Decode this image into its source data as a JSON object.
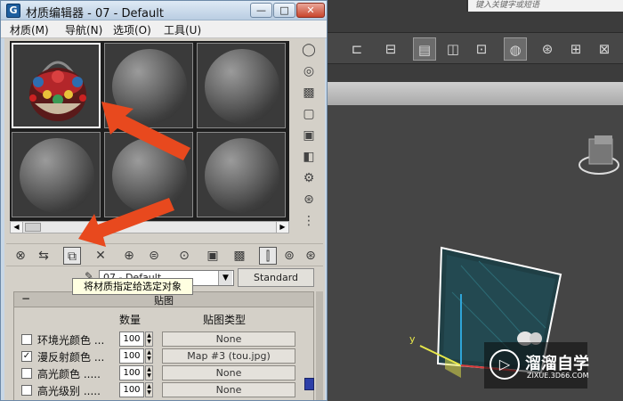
{
  "window": {
    "title": "材质编辑器 - 07 - Default",
    "app_icon": "3dsmax-logo-icon",
    "controls": {
      "minimize": "—",
      "maximize": "□",
      "close": "✕"
    }
  },
  "menu": [
    {
      "label": "材质(M)"
    },
    {
      "label": "导航(N)"
    },
    {
      "label": "选项(O)"
    },
    {
      "label": "工具(U)"
    }
  ],
  "material": {
    "eyedropper_icon": "eyedropper-icon",
    "name": "07 - Default",
    "type_button": "Standard"
  },
  "tooltip": "将材质指定给选定对象",
  "maps_rollout": {
    "collapse": "−",
    "title": "贴图",
    "col_amount": "数量",
    "col_map_type": "贴图类型",
    "rows": [
      {
        "label": "环境光颜色 ...",
        "checked": false,
        "check_mark": "",
        "amount": "100",
        "map": "None"
      },
      {
        "label": "漫反射颜色 ...",
        "checked": true,
        "check_mark": "✓",
        "amount": "100",
        "map": "Map #3 (tou.jpg)"
      },
      {
        "label": "高光颜色 .....",
        "checked": false,
        "check_mark": "",
        "amount": "100",
        "map": "None"
      },
      {
        "label": "高光级别 .....",
        "checked": false,
        "check_mark": "",
        "amount": "100",
        "map": "None"
      }
    ]
  },
  "max_ui": {
    "search_placeholder": "键入关键字或短语"
  },
  "watermark": {
    "logo_glyph": "▷",
    "name": "溜溜自学",
    "url": "ZIXUE.3D66.COM"
  },
  "colors": {
    "annotation_arrow": "#e8491e",
    "window_frame": "#c8d7e6",
    "viewport_bg": "#454545"
  }
}
